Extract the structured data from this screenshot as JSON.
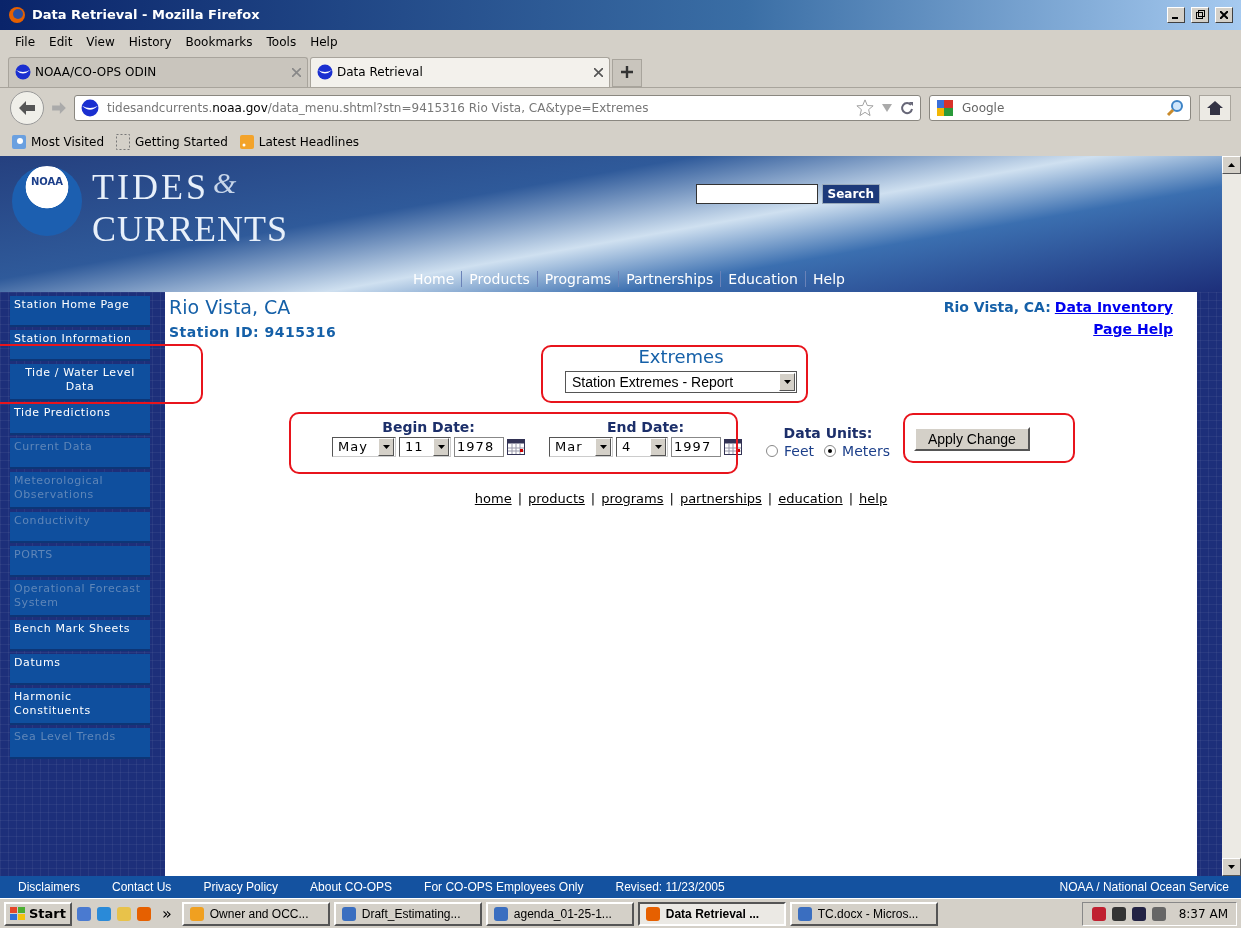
{
  "window": {
    "title": "Data Retrieval - Mozilla Firefox"
  },
  "menu": [
    "File",
    "Edit",
    "View",
    "History",
    "Bookmarks",
    "Tools",
    "Help"
  ],
  "tabs": [
    {
      "label": "NOAA/CO-OPS ODIN",
      "selected": false
    },
    {
      "label": "Data Retrieval",
      "selected": true
    }
  ],
  "address": {
    "subdomain": "tidesandcurrents.",
    "domain": "noaa.gov",
    "path": "/data_menu.shtml?stn=9415316 Rio Vista, CA&type=Extremes"
  },
  "search": {
    "placeholder": "Google"
  },
  "bookmarks": [
    "Most Visited",
    "Getting Started",
    "Latest Headlines"
  ],
  "banner": {
    "logo_badge": "NOAA",
    "title_top": "TIDES",
    "title_amp": "&",
    "title_bottom": "CURRENTS",
    "search_button": "Search",
    "nav": [
      "Home",
      "Products",
      "Programs",
      "Partnerships",
      "Education",
      "Help"
    ]
  },
  "sidebar": [
    {
      "label": "Station Home Page",
      "disabled": false
    },
    {
      "label": "Station Information",
      "disabled": false
    },
    {
      "label": "Tide / Water Level Data",
      "disabled": false
    },
    {
      "label": "Tide Predictions",
      "disabled": false
    },
    {
      "label": "Current Data",
      "disabled": true
    },
    {
      "label": "Meteorological Observations",
      "disabled": true
    },
    {
      "label": "Conductivity",
      "disabled": true
    },
    {
      "label": "PORTS",
      "disabled": true
    },
    {
      "label": "Operational Forecast System",
      "disabled": true
    },
    {
      "label": "Bench Mark Sheets",
      "disabled": false
    },
    {
      "label": "Datums",
      "disabled": false
    },
    {
      "label": "Harmonic Constituents",
      "disabled": false
    },
    {
      "label": "Sea Level Trends",
      "disabled": true
    }
  ],
  "station": {
    "name": "Rio Vista, CA",
    "id": "Station ID: 9415316",
    "inventory_label": "Rio Vista, CA:",
    "inventory_link": "Data Inventory",
    "help_link": "Page Help"
  },
  "product": {
    "heading": "Extremes",
    "select": "Station Extremes - Report"
  },
  "begin_date": {
    "label": "Begin Date:",
    "month": "May",
    "day": "11",
    "year": "1978"
  },
  "end_date": {
    "label": "End Date:",
    "month": "Mar",
    "day": "4",
    "year": "1997"
  },
  "units": {
    "label": "Data Units:",
    "options": [
      {
        "label": "Feet",
        "selected": false
      },
      {
        "label": "Meters",
        "selected": true
      }
    ]
  },
  "apply_button": "Apply Change",
  "link_separator": "|",
  "links": [
    "home",
    "products",
    "programs",
    "partnerships",
    "education",
    "help"
  ],
  "footer": {
    "items": [
      "Disclaimers",
      "Contact Us",
      "Privacy Policy",
      "About CO-OPS",
      "For CO-OPS Employees Only",
      "Revised: 11/23/2005"
    ],
    "right": "NOAA / National Ocean Service"
  },
  "taskbar": {
    "start": "Start",
    "more": "»",
    "tasks": [
      {
        "label": "Owner and OCC...",
        "selected": false
      },
      {
        "label": "Draft_Estimating...",
        "selected": false
      },
      {
        "label": "agenda_01-25-1...",
        "selected": false
      },
      {
        "label": "Data Retrieval ...",
        "selected": true
      },
      {
        "label": "TC.docx - Micros...",
        "selected": false
      }
    ],
    "time": "8:37 AM"
  }
}
